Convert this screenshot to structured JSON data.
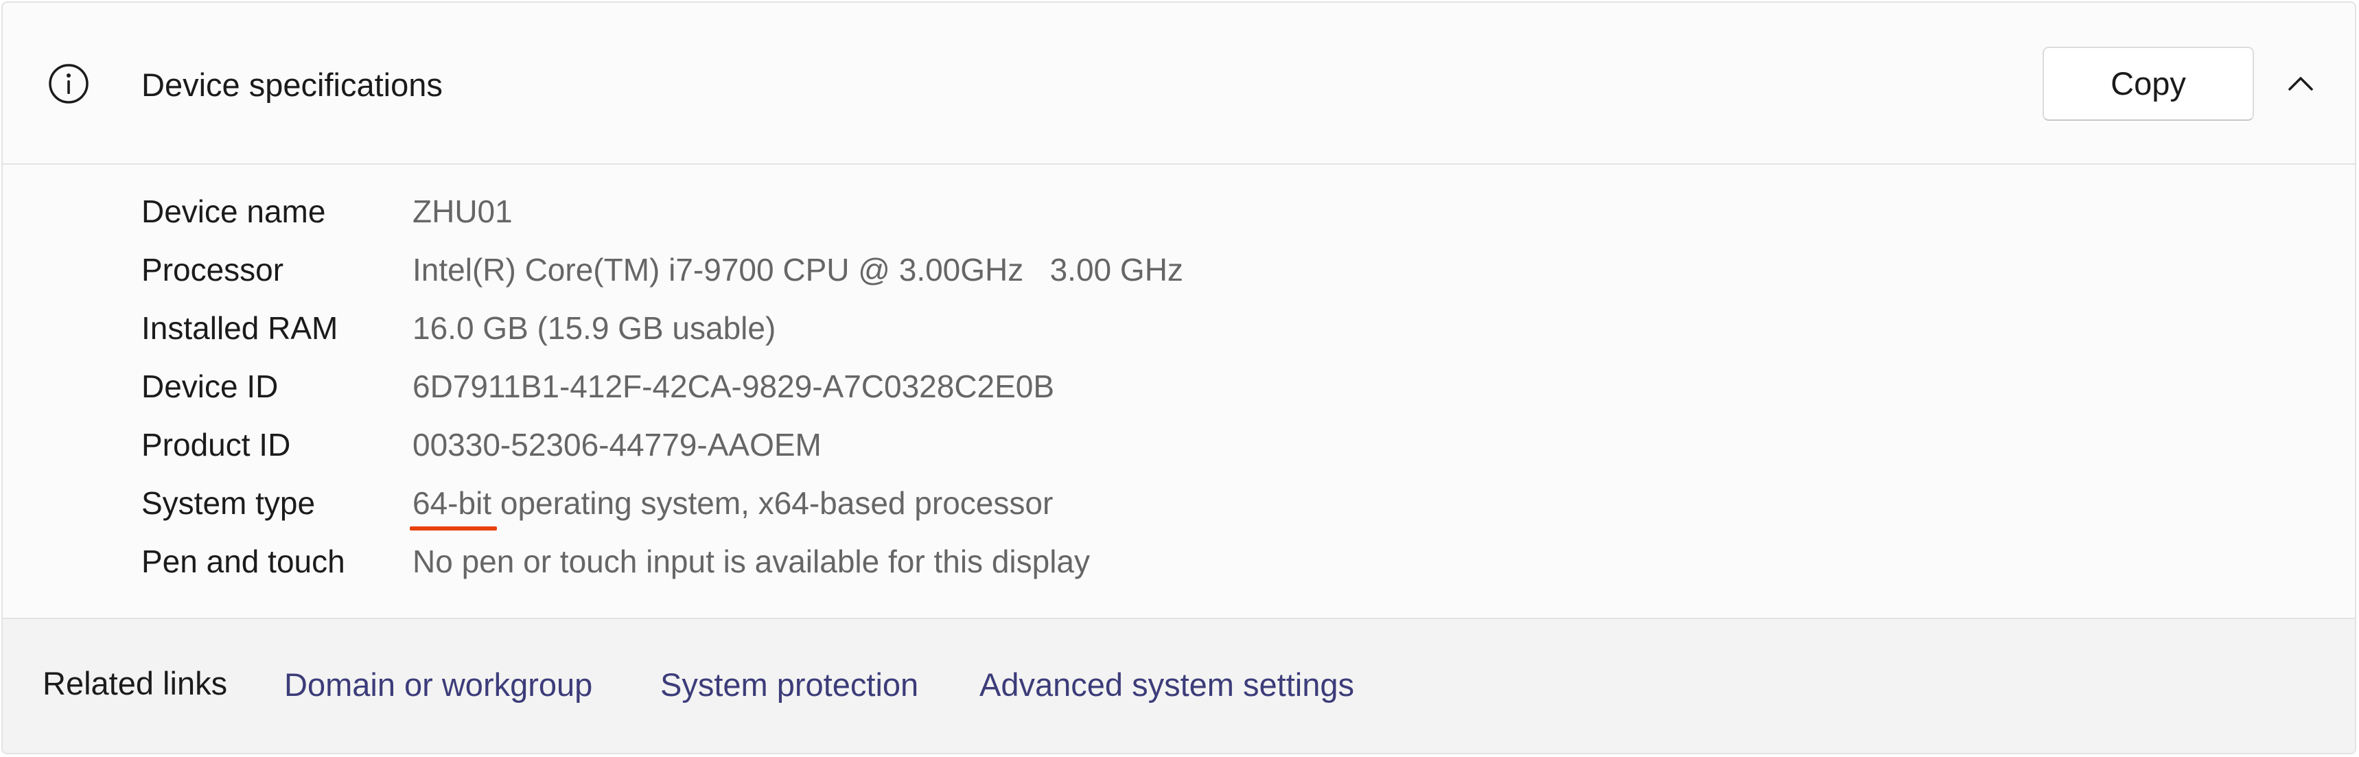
{
  "header": {
    "title": "Device specifications",
    "icon": "info-icon",
    "copy_label": "Copy",
    "collapse_icon": "chevron-up-icon"
  },
  "specs": [
    {
      "label": "Device name",
      "value": "ZHU01"
    },
    {
      "label": "Processor",
      "value": "Intel(R) Core(TM) i7-9700 CPU @ 3.00GHz   3.00 GHz"
    },
    {
      "label": "Installed RAM",
      "value": "16.0 GB (15.9 GB usable)"
    },
    {
      "label": "Device ID",
      "value": "6D7911B1-412F-42CA-9829-A7C0328C2E0B"
    },
    {
      "label": "Product ID",
      "value": "00330-52306-44779-AAOEM"
    },
    {
      "label": "System type",
      "value_highlight": "64-bit",
      "value_rest": " operating system, x64-based processor"
    },
    {
      "label": "Pen and touch",
      "value": "No pen or touch input is available for this display"
    }
  ],
  "related": {
    "title": "Related links",
    "links": [
      "Domain or workgroup",
      "System protection",
      "Advanced system settings"
    ]
  },
  "colors": {
    "link": "#3c3c7a",
    "underline_mark": "#e8420a",
    "value_text": "#666666"
  }
}
